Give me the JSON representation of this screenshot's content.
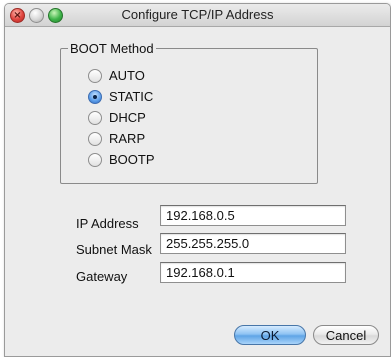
{
  "window": {
    "title": "Configure TCP/IP Address",
    "close_glyph": "×",
    "minimize_glyph": "",
    "zoom_glyph": ""
  },
  "boot_method": {
    "legend": "BOOT Method",
    "options": [
      {
        "label": "AUTO",
        "selected": false
      },
      {
        "label": "STATIC",
        "selected": true
      },
      {
        "label": "DHCP",
        "selected": false
      },
      {
        "label": "RARP",
        "selected": false
      },
      {
        "label": "BOOTP",
        "selected": false
      }
    ]
  },
  "fields": {
    "ip_address": {
      "label": "IP Address",
      "value": "192.168.0.5"
    },
    "subnet_mask": {
      "label": "Subnet Mask",
      "value": "255.255.255.0"
    },
    "gateway": {
      "label": "Gateway",
      "value": "192.168.0.1"
    }
  },
  "buttons": {
    "ok": "OK",
    "cancel": "Cancel"
  },
  "colors": {
    "default_button": "#5fa4e6",
    "selected_radio": "#5a9ce8",
    "window_background": "#ececec"
  }
}
